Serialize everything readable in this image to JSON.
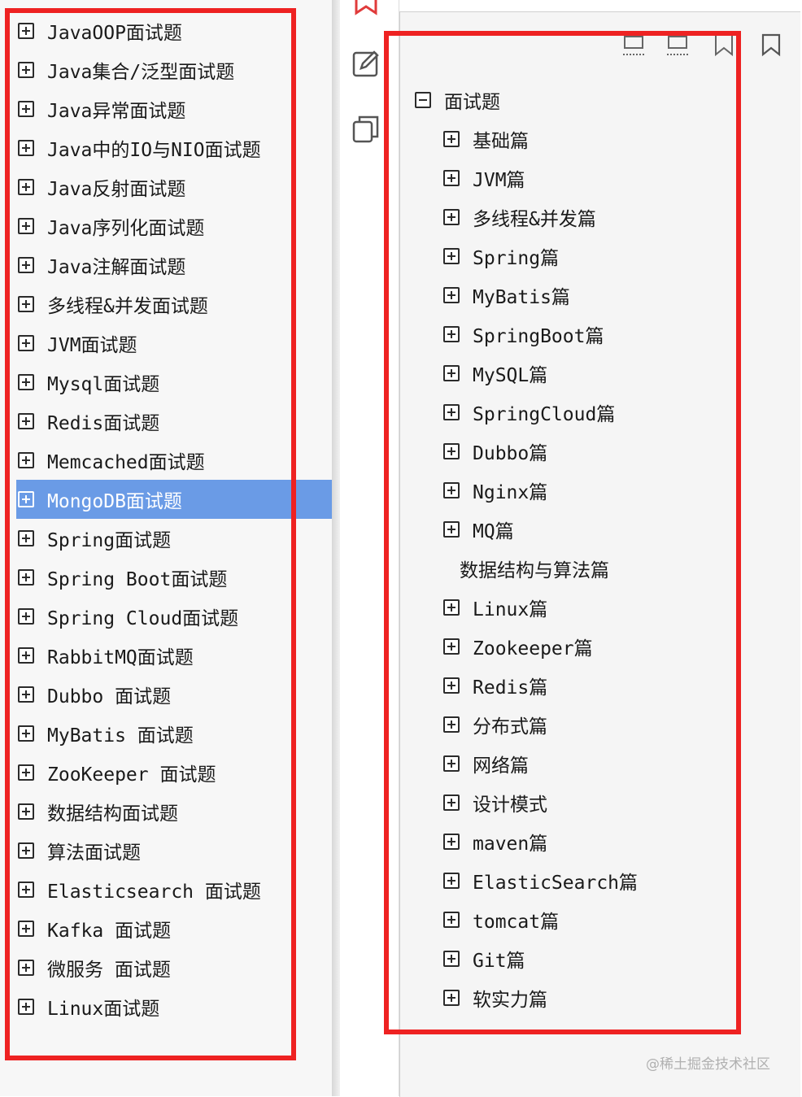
{
  "left_tree": {
    "items": [
      {
        "label": "JavaOOP面试题"
      },
      {
        "label": "Java集合/泛型面试题"
      },
      {
        "label": "Java异常面试题"
      },
      {
        "label": "Java中的IO与NIO面试题"
      },
      {
        "label": "Java反射面试题"
      },
      {
        "label": "Java序列化面试题"
      },
      {
        "label": "Java注解面试题"
      },
      {
        "label": "多线程&并发面试题"
      },
      {
        "label": "JVM面试题"
      },
      {
        "label": "Mysql面试题"
      },
      {
        "label": "Redis面试题"
      },
      {
        "label": "Memcached面试题"
      },
      {
        "label": "MongoDB面试题"
      },
      {
        "label": "Spring面试题"
      },
      {
        "label": "Spring Boot面试题"
      },
      {
        "label": "Spring Cloud面试题"
      },
      {
        "label": "RabbitMQ面试题"
      },
      {
        "label": "Dubbo 面试题"
      },
      {
        "label": "MyBatis 面试题"
      },
      {
        "label": "ZooKeeper 面试题"
      },
      {
        "label": "数据结构面试题"
      },
      {
        "label": "算法面试题"
      },
      {
        "label": "Elasticsearch 面试题"
      },
      {
        "label": "Kafka 面试题"
      },
      {
        "label": "微服务 面试题"
      },
      {
        "label": "Linux面试题"
      }
    ],
    "selected_index": 12
  },
  "right_tree": {
    "root": {
      "label": "面试题"
    },
    "children": [
      {
        "label": "基础篇"
      },
      {
        "label": "JVM篇"
      },
      {
        "label": "多线程&并发篇"
      },
      {
        "label": "Spring篇"
      },
      {
        "label": "MyBatis篇"
      },
      {
        "label": "SpringBoot篇"
      },
      {
        "label": "MySQL篇"
      },
      {
        "label": "SpringCloud篇"
      },
      {
        "label": "Dubbo篇"
      },
      {
        "label": "Nginx篇"
      },
      {
        "label": "MQ篇"
      },
      {
        "label": "数据结构与算法篇"
      },
      {
        "label": "Linux篇"
      },
      {
        "label": "Zookeeper篇"
      },
      {
        "label": "Redis篇"
      },
      {
        "label": "分布式篇"
      },
      {
        "label": "网络篇"
      },
      {
        "label": "设计模式"
      },
      {
        "label": "maven篇"
      },
      {
        "label": "ElasticSearch篇"
      },
      {
        "label": "tomcat篇"
      },
      {
        "label": "Git篇"
      },
      {
        "label": "软实力篇"
      }
    ]
  },
  "toolstrip": {
    "icons": [
      "bookmark-icon",
      "edit-icon",
      "copy-icon"
    ]
  },
  "bookmark_toolbar": {
    "icons": [
      "expand-all-icon",
      "collapse-all-icon",
      "add-bookmark-icon",
      "bookmark-icon"
    ]
  },
  "watermark": "@稀土掘金技术社区",
  "colors": {
    "selection": "#6a9be6",
    "highlight_box": "#ee2222"
  }
}
